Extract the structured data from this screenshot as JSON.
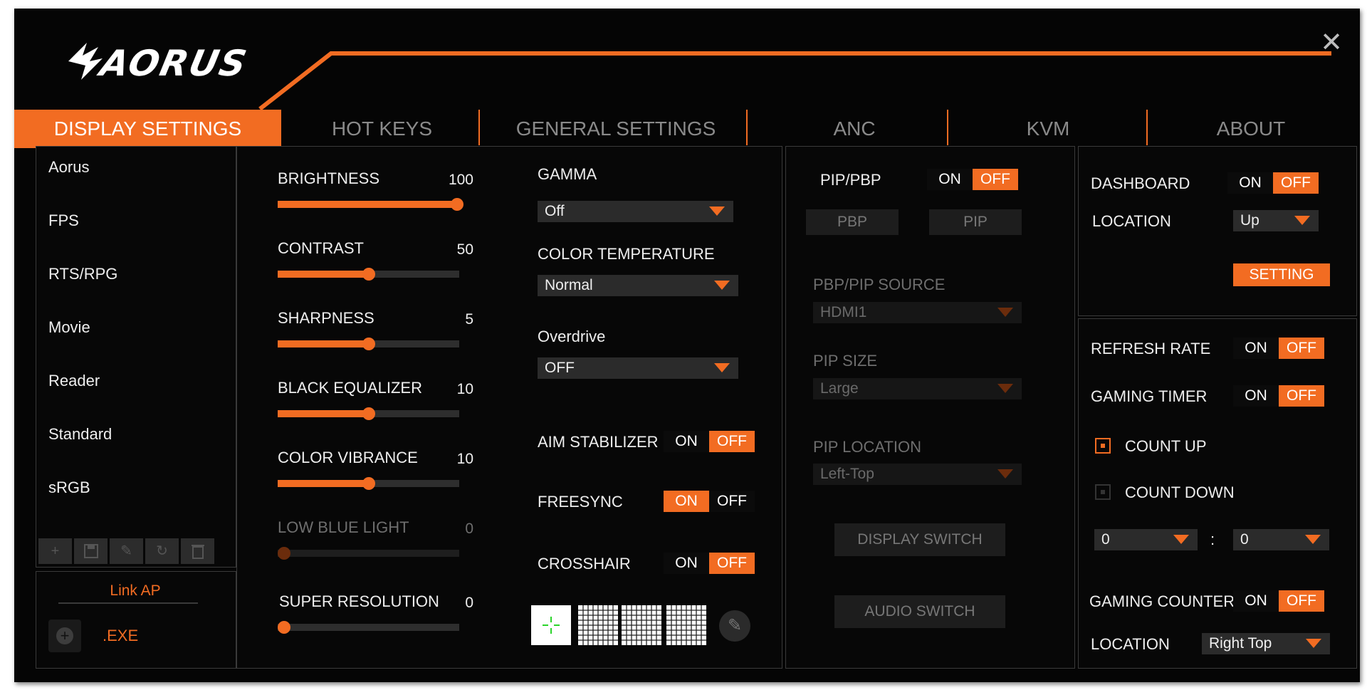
{
  "brand": "AORUS",
  "colors": {
    "accent": "#f26c22",
    "background": "#050505"
  },
  "tabs": [
    {
      "label": "DISPLAY SETTINGS",
      "active": true
    },
    {
      "label": "HOT KEYS"
    },
    {
      "label": "GENERAL SETTINGS"
    },
    {
      "label": "ANC"
    },
    {
      "label": "KVM"
    },
    {
      "label": "ABOUT"
    }
  ],
  "presets": [
    "Aorus",
    "FPS",
    "RTS/RPG",
    "Movie",
    "Reader",
    "Standard",
    "sRGB"
  ],
  "preset_toolbar_icons": [
    "plus-icon",
    "save-icon",
    "pencil-icon",
    "refresh-icon",
    "trash-icon"
  ],
  "link_ap": {
    "title": "Link AP",
    "exe": ".EXE"
  },
  "sliders": [
    {
      "label": "BRIGHTNESS",
      "value": "100",
      "fraction": 1.0
    },
    {
      "label": "CONTRAST",
      "value": "50",
      "fraction": 0.5
    },
    {
      "label": "SHARPNESS",
      "value": "5",
      "fraction": 0.5
    },
    {
      "label": "BLACK EQUALIZER",
      "value": "10",
      "fraction": 0.5
    },
    {
      "label": "COLOR VIBRANCE",
      "value": "10",
      "fraction": 0.5
    },
    {
      "label": "LOW BLUE LIGHT",
      "value": "0",
      "fraction": 0.0,
      "disabled": true
    },
    {
      "label": "SUPER RESOLUTION",
      "value": "0",
      "fraction": 0.0
    }
  ],
  "gamma": {
    "label": "GAMMA",
    "value": "Off"
  },
  "color_temperature": {
    "label": "COLOR TEMPERATURE",
    "value": "Normal"
  },
  "overdrive": {
    "label": "Overdrive",
    "value": "OFF"
  },
  "toggle_labels": {
    "on": "ON",
    "off": "OFF"
  },
  "aim_stabilizer": {
    "label": "AIM STABILIZER",
    "state": "OFF"
  },
  "freesync": {
    "label": "FREESYNC",
    "state": "ON"
  },
  "crosshair": {
    "label": "CROSSHAIR",
    "state": "OFF"
  },
  "pip": {
    "label": "PIP/PBP",
    "state": "OFF",
    "pbp_button": "PBP",
    "pip_button": "PIP",
    "source_label": "PBP/PIP SOURCE",
    "source_value": "HDMI1",
    "size_label": "PIP SIZE",
    "size_value": "Large",
    "location_label": "PIP LOCATION",
    "location_value": "Left-Top",
    "display_switch": "DISPLAY SWITCH",
    "audio_switch": "AUDIO SWITCH"
  },
  "dashboard": {
    "label": "DASHBOARD",
    "state": "OFF",
    "location_label": "LOCATION",
    "location_value": "Up",
    "setting_button": "SETTING"
  },
  "refresh_rate": {
    "label": "REFRESH RATE",
    "state": "OFF"
  },
  "gaming_timer": {
    "label": "GAMING TIMER",
    "state": "OFF",
    "count_up": "COUNT UP",
    "count_down": "COUNT DOWN",
    "minutes": "0",
    "separator": ":",
    "seconds": "0"
  },
  "gaming_counter": {
    "label": "GAMING COUNTER",
    "state": "OFF",
    "location_label": "LOCATION",
    "location_value": "Right Top"
  }
}
